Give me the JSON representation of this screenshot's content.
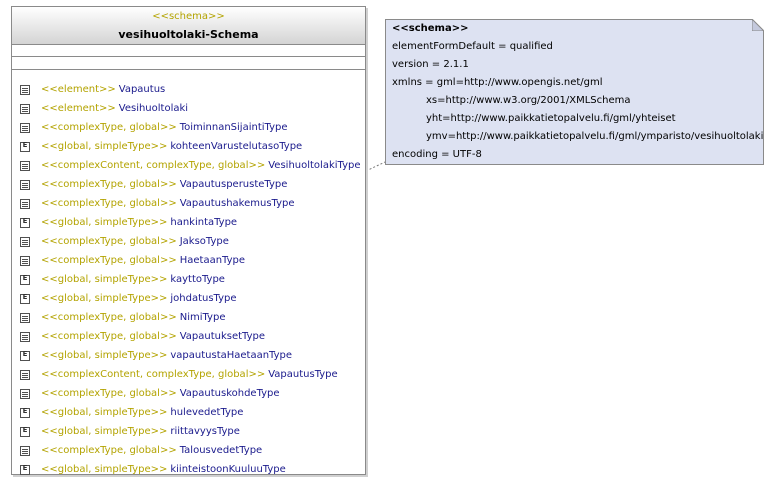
{
  "class": {
    "stereotype": "<<schema>>",
    "name": "vesihuoltolaki-Schema",
    "members": [
      {
        "icon": "element",
        "stereotype": "<<element>>",
        "name": "Vapautus"
      },
      {
        "icon": "element",
        "stereotype": "<<element>>",
        "name": "Vesihuoltolaki"
      },
      {
        "icon": "element",
        "stereotype": "<<complexType, global>>",
        "name": "ToiminnanSijaintiType"
      },
      {
        "icon": "enum",
        "stereotype": "<<global, simpleType>>",
        "name": "kohteenVarustelutasoType"
      },
      {
        "icon": "element",
        "stereotype": "<<complexContent, complexType, global>>",
        "name": "VesihuoltolakiType"
      },
      {
        "icon": "element",
        "stereotype": "<<complexType, global>>",
        "name": "VapautusperusteType"
      },
      {
        "icon": "element",
        "stereotype": "<<complexType, global>>",
        "name": "VapautushakemusType"
      },
      {
        "icon": "enum",
        "stereotype": "<<global, simpleType>>",
        "name": "hankintaType"
      },
      {
        "icon": "element",
        "stereotype": "<<complexType, global>>",
        "name": "JaksoType"
      },
      {
        "icon": "element",
        "stereotype": "<<complexType, global>>",
        "name": "HaetaanType"
      },
      {
        "icon": "enum",
        "stereotype": "<<global, simpleType>>",
        "name": "kayttoType"
      },
      {
        "icon": "enum",
        "stereotype": "<<global, simpleType>>",
        "name": "johdatusType"
      },
      {
        "icon": "element",
        "stereotype": "<<complexType, global>>",
        "name": "NimiType"
      },
      {
        "icon": "element",
        "stereotype": "<<complexType, global>>",
        "name": "VapautuksetType"
      },
      {
        "icon": "enum",
        "stereotype": "<<global, simpleType>>",
        "name": "vapautustaHaetaanType"
      },
      {
        "icon": "element",
        "stereotype": "<<complexContent, complexType, global>>",
        "name": "VapautusType"
      },
      {
        "icon": "element",
        "stereotype": "<<complexType, global>>",
        "name": "VapautuskohdeType"
      },
      {
        "icon": "enum",
        "stereotype": "<<global, simpleType>>",
        "name": "hulevedetType"
      },
      {
        "icon": "enum",
        "stereotype": "<<global, simpleType>>",
        "name": "riittavyysType"
      },
      {
        "icon": "element",
        "stereotype": "<<complexType, global>>",
        "name": "TalousvedetType"
      },
      {
        "icon": "enum",
        "stereotype": "<<global, simpleType>>",
        "name": "kiinteistoonKuuluuType"
      }
    ]
  },
  "note": {
    "title": "<<schema>>",
    "lines": [
      {
        "text": "elementFormDefault = qualified",
        "indent": false
      },
      {
        "text": "version = 2.1.1",
        "indent": false
      },
      {
        "text": "xmlns = gml=http://www.opengis.net/gml",
        "indent": false
      },
      {
        "text": "xs=http://www.w3.org/2001/XMLSchema",
        "indent": true
      },
      {
        "text": "yht=http://www.paikkatietopalvelu.fi/gml/yhteiset",
        "indent": true
      },
      {
        "text": "ymv=http://www.paikkatietopalvelu.fi/gml/ymparisto/vesihuoltolaki",
        "indent": true
      },
      {
        "text": "encoding = UTF-8",
        "indent": false
      }
    ]
  },
  "colors": {
    "stereotype": "#b3a300",
    "member_name": "#1a1a8c",
    "note_fill": "#dde2f2",
    "border": "#8a8a8a"
  }
}
